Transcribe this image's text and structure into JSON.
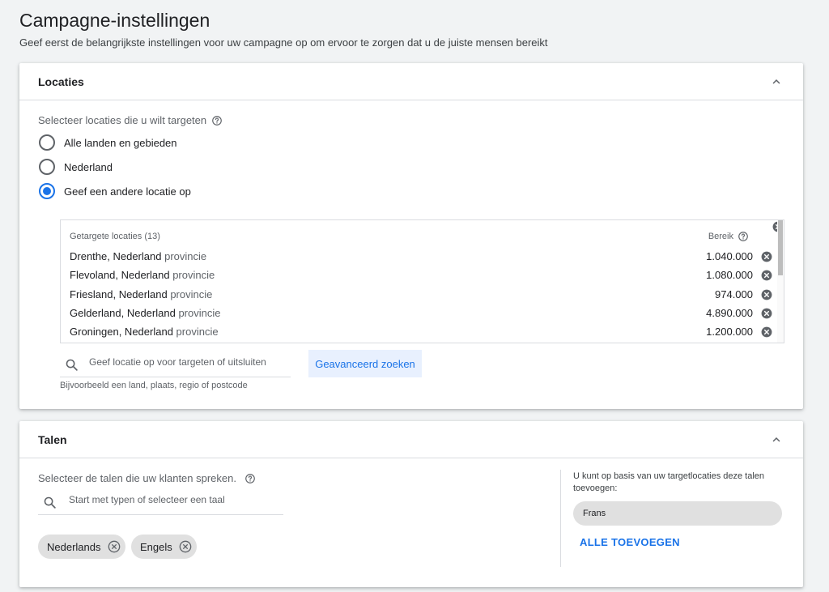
{
  "page": {
    "title": "Campagne-instellingen",
    "subtitle": "Geef eerst de belangrijkste instellingen voor uw campagne op om ervoor te zorgen dat u de juiste mensen bereikt"
  },
  "locations": {
    "title": "Locaties",
    "collapse_icon": "chevron-up-icon",
    "prompt": "Selecteer locaties die u wilt targeten",
    "options": [
      {
        "label": "Alle landen en gebieden",
        "selected": false
      },
      {
        "label": "Nederland",
        "selected": false
      },
      {
        "label": "Geef een andere locatie op",
        "selected": true
      }
    ],
    "targeted_header": "Getargete locaties (13)",
    "reach_header": "Bereik",
    "rows": [
      {
        "name": "Drenthe, Nederland",
        "type": "provincie",
        "reach": "1.040.000"
      },
      {
        "name": "Flevoland, Nederland",
        "type": "provincie",
        "reach": "1.080.000"
      },
      {
        "name": "Friesland, Nederland",
        "type": "provincie",
        "reach": "974.000"
      },
      {
        "name": "Gelderland, Nederland",
        "type": "provincie",
        "reach": "4.890.000"
      },
      {
        "name": "Groningen, Nederland",
        "type": "provincie",
        "reach": "1.200.000"
      }
    ],
    "search_placeholder": "Geef locatie op voor targeten of uitsluiten",
    "search_hint": "Bijvoorbeeld een land, plaats, regio of postcode",
    "advanced_button": "Geavanceerd zoeken"
  },
  "languages": {
    "title": "Talen",
    "prompt": "Selecteer de talen die uw klanten spreken.",
    "search_placeholder": "Start met typen of selecteer een taal",
    "selected": [
      "Nederlands",
      "Engels"
    ],
    "suggestion_text": "U kunt op basis van uw targetlocaties deze talen toevoegen:",
    "suggestions": [
      "Frans"
    ],
    "add_all": "ALLE TOEVOEGEN"
  },
  "colors": {
    "accent": "#1a73e8",
    "chip_bg": "#e0e0e0",
    "button_bg": "#e8f0fe"
  }
}
